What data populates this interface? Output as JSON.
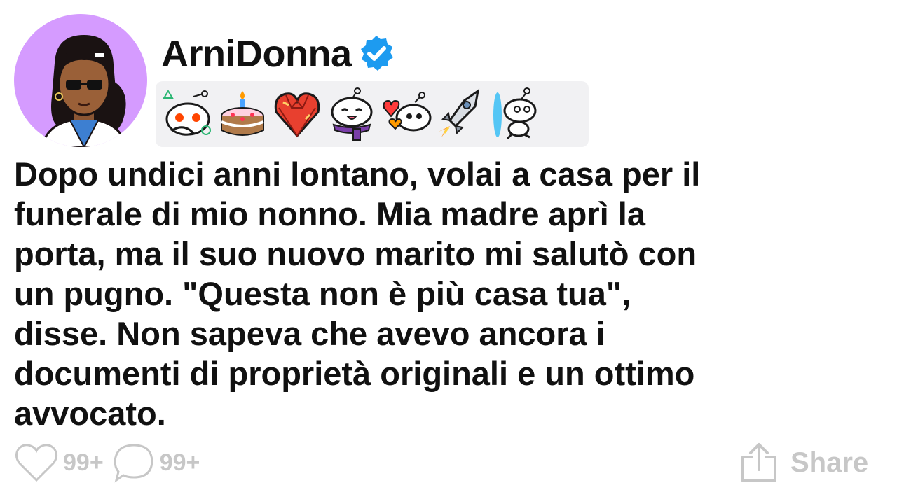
{
  "post": {
    "username": "ArniDonna",
    "avatar_icon": "avatar-illustration",
    "verified_icon": "verified-badge-icon",
    "badges": [
      {
        "icon": "snoo-peeking-badge-icon"
      },
      {
        "icon": "birthday-cake-badge-icon"
      },
      {
        "icon": "crystal-heart-badge-icon"
      },
      {
        "icon": "snoo-scarf-badge-icon"
      },
      {
        "icon": "snoo-heart-balloons-badge-icon"
      },
      {
        "icon": "rocket-badge-icon"
      },
      {
        "icon": "snoo-portal-badge-icon"
      }
    ],
    "body": "Dopo undici anni lontano, volai a casa per il\nfunerale di mio nonno. Mia madre aprì la\nporta, ma il suo nuovo marito mi salutò con\nun pugno. \"Questa non è più casa tua\",\ndisse. Non sapeva che avevo ancora i\ndocumenti di proprietà originali e un ottimo\navvocato."
  },
  "actions": {
    "likes": "99+",
    "comments": "99+",
    "share_label": "Share"
  },
  "colors": {
    "avatar_bg": "#d59bff",
    "verified": "#1d9bf0",
    "badge_strip_bg": "#f1f1f3",
    "muted": "#c7c7c7",
    "text": "#111111"
  }
}
